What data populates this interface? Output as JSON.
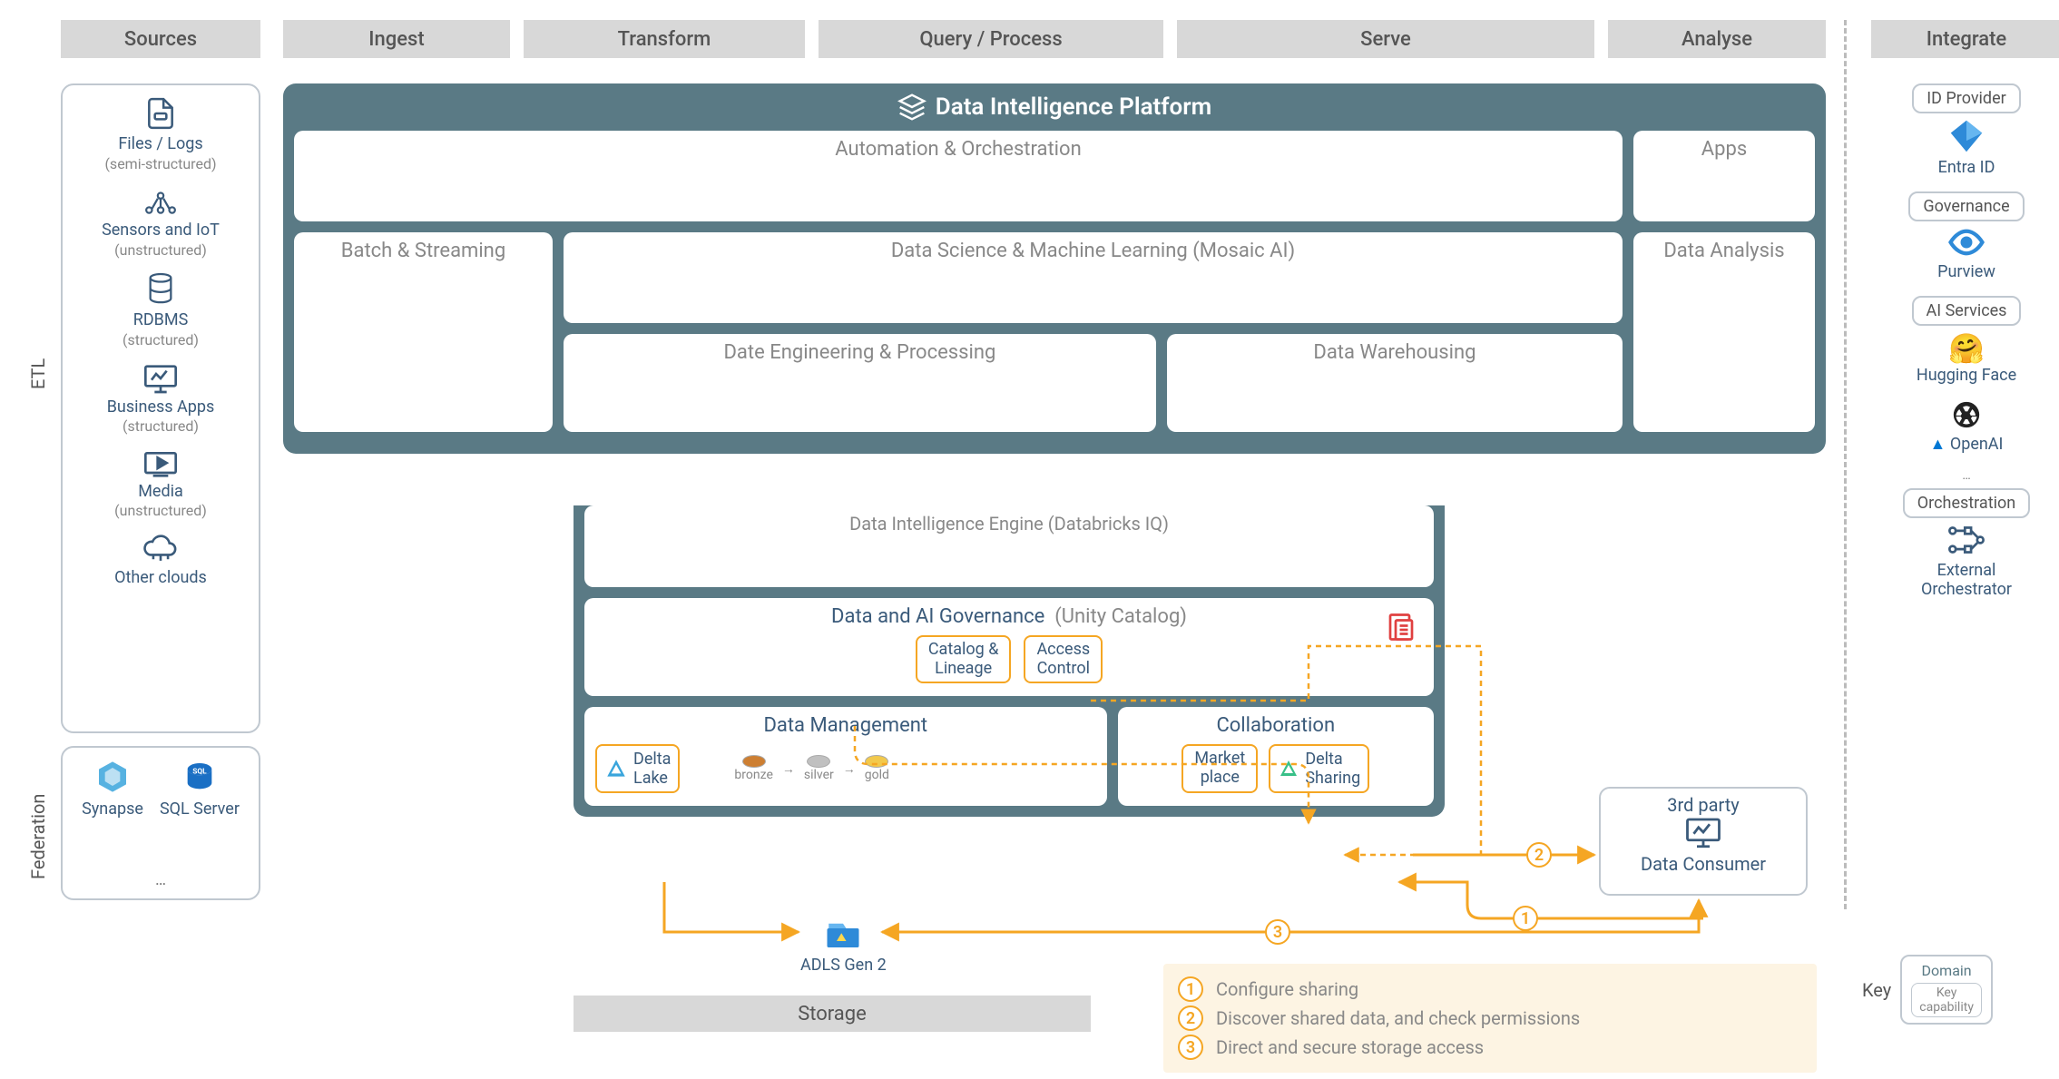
{
  "bands": {
    "sources": "Sources",
    "ingest": "Ingest",
    "transform": "Transform",
    "query": "Query / Process",
    "serve": "Serve",
    "analyse": "Analyse",
    "integrate": "Integrate"
  },
  "side_labels": {
    "etl": "ETL",
    "federation": "Federation"
  },
  "sources": [
    {
      "title": "Files / Logs",
      "sub": "(semi-structured)"
    },
    {
      "title": "Sensors and IoT",
      "sub": "(unstructured)"
    },
    {
      "title": "RDBMS",
      "sub": "(structured)"
    },
    {
      "title": "Business Apps",
      "sub": "(structured)"
    },
    {
      "title": "Media",
      "sub": "(unstructured)"
    },
    {
      "title": "Other clouds",
      "sub": ""
    }
  ],
  "federation": {
    "items": [
      "Synapse",
      "SQL Server"
    ],
    "more": "…"
  },
  "platform": {
    "title": "Data Intelligence Platform",
    "automation": "Automation & Orchestration",
    "apps": "Apps",
    "batch": "Batch & Streaming",
    "dsml": "Data Science & Machine Learning  (Mosaic AI)",
    "data_analysis": "Data Analysis",
    "de": "Date Engineering & Processing",
    "dw": "Data Warehousing",
    "engine": "Data Intelligence Engine  (Databricks IQ)",
    "gov": {
      "title": "Data and AI Governance",
      "sub": "(Unity Catalog)",
      "catalog": "Catalog &\nLineage",
      "access": "Access\nControl"
    },
    "dm": {
      "title": "Data Management",
      "delta": "Delta\nLake",
      "bronze": "bronze",
      "silver": "silver",
      "gold": "gold"
    },
    "collab": {
      "title": "Collaboration",
      "market": "Market\nplace",
      "sharing": "Delta\nSharing"
    }
  },
  "third_party": {
    "title": "3rd party",
    "consumer": "Data Consumer"
  },
  "storage": {
    "adls": "ADLS Gen 2",
    "label": "Storage"
  },
  "steps": [
    {
      "n": "1",
      "text": "Configure sharing"
    },
    {
      "n": "2",
      "text": "Discover shared data, and check permissions"
    },
    {
      "n": "3",
      "text": "Direct and secure storage access"
    }
  ],
  "integrate": {
    "id_provider": "ID Provider",
    "entra": "Entra ID",
    "governance": "Governance",
    "purview": "Purview",
    "ai_services": "AI Services",
    "hf": "Hugging Face",
    "openai": "OpenAI",
    "more": "…",
    "orchestration": "Orchestration",
    "ext_orch": "External\nOrchestrator"
  },
  "key": {
    "label": "Key",
    "domain": "Domain",
    "cap": "Key\ncapability"
  }
}
